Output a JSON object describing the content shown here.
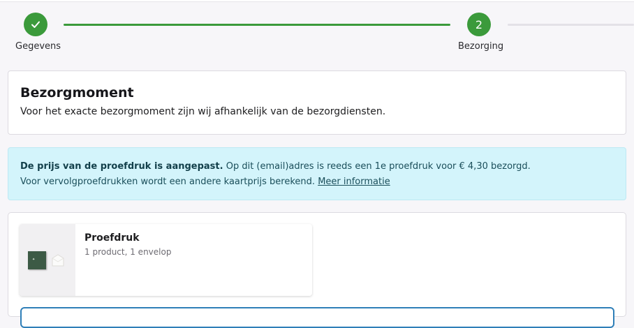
{
  "stepper": {
    "steps": [
      {
        "label": "Gegevens",
        "number": "",
        "state": "done"
      },
      {
        "label": "Bezorging",
        "number": "2",
        "state": "active"
      }
    ],
    "color_done": "#3b9a3b",
    "icon_done": "check-icon"
  },
  "bezorgmoment": {
    "title": "Bezorgmoment",
    "text": "Voor het exacte bezorgmoment zijn wij afhankelijk van de bezorgdiensten."
  },
  "notice": {
    "bold": "De prijs van de proefdruk is aangepast.",
    "text1": " Op dit (email)adres is reeds een 1e proefdruk voor € 4,30 bezorgd.",
    "text2": "Voor vervolgproefdrukken wordt een andere kaartprijs berekend. ",
    "link": "Meer informatie",
    "background": "#d3f4fb"
  },
  "order": {
    "product_title": "Proefdruk",
    "product_sub": "1 product, 1 envelop"
  }
}
